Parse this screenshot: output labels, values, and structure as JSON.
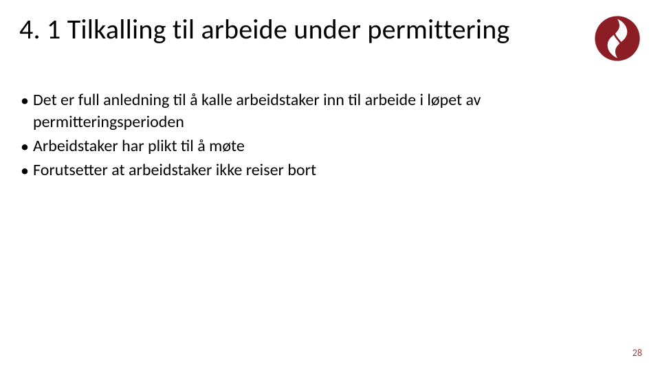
{
  "title": "4. 1 Tilkalling til arbeide under permittering",
  "bullets": [
    "Det er full anledning til å kalle arbeidstaker inn til arbeide i løpet av permitteringsperioden",
    "Arbeidstaker har plikt til å møte",
    "Forutsetter at arbeidstaker ikke reiser bort"
  ],
  "page_number": "28",
  "logo": {
    "name": "organization-logo",
    "bg_color": "#8c1d24",
    "fg_color": "#ffffff"
  }
}
